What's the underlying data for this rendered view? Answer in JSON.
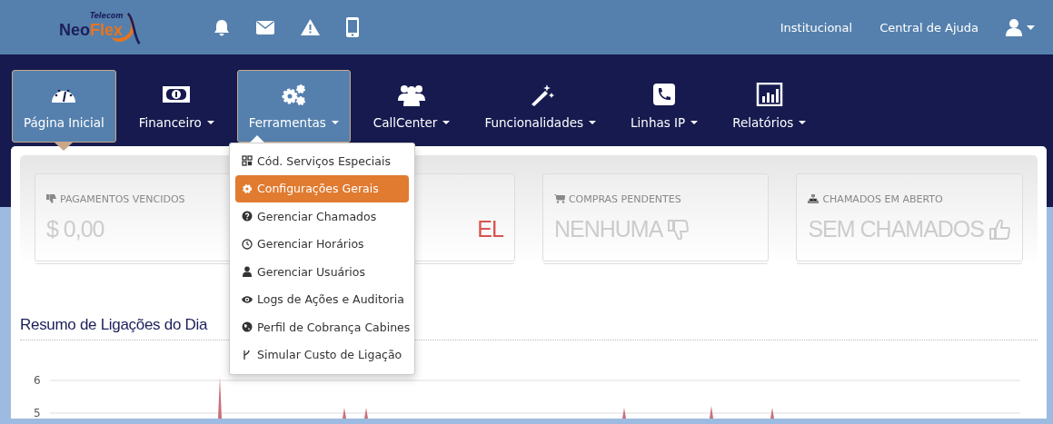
{
  "logo": {
    "tagline": "Telecom",
    "name_a": "Neo",
    "name_b": "Flex"
  },
  "header_links": [
    "Institucional",
    "Central de Ajuda"
  ],
  "nav": [
    {
      "label": "Página Inicial",
      "selected": true,
      "expanded": false,
      "dropdown": false
    },
    {
      "label": "Financeiro",
      "selected": false,
      "expanded": false,
      "dropdown": true
    },
    {
      "label": "Ferramentas",
      "selected": false,
      "expanded": true,
      "dropdown": true
    },
    {
      "label": "CallCenter",
      "selected": false,
      "expanded": false,
      "dropdown": true
    },
    {
      "label": "Funcionalidades",
      "selected": false,
      "expanded": false,
      "dropdown": true
    },
    {
      "label": "Linhas IP",
      "selected": false,
      "expanded": false,
      "dropdown": true
    },
    {
      "label": "Relatórios",
      "selected": false,
      "expanded": false,
      "dropdown": true
    }
  ],
  "menu": [
    {
      "label": "Cód. Serviços Especiais",
      "selected": false
    },
    {
      "label": "Configurações Gerais",
      "selected": true
    },
    {
      "label": "Gerenciar Chamados",
      "selected": false
    },
    {
      "label": "Gerenciar Horários",
      "selected": false
    },
    {
      "label": "Gerenciar Usuários",
      "selected": false
    },
    {
      "label": "Logs de Ações e Auditoria",
      "selected": false
    },
    {
      "label": "Perfil de Cobrança Cabines",
      "selected": false
    },
    {
      "label": "Simular Custo de Ligação",
      "selected": false
    }
  ],
  "stats": [
    {
      "label": "PAGAMENTOS VENCIDOS",
      "value": "$ 0,00",
      "alert": false
    },
    {
      "value": "EL",
      "alert": true
    },
    {
      "label": "COMPRAS PENDENTES",
      "value": "NENHUMA",
      "alert": false
    },
    {
      "label": "CHAMADOS EM ABERTO",
      "value": "SEM CHAMADOS",
      "alert": false
    }
  ],
  "chart": {
    "title": "Resumo de Ligações do Dia",
    "y_tick_labels": [
      "6",
      "5"
    ]
  }
}
